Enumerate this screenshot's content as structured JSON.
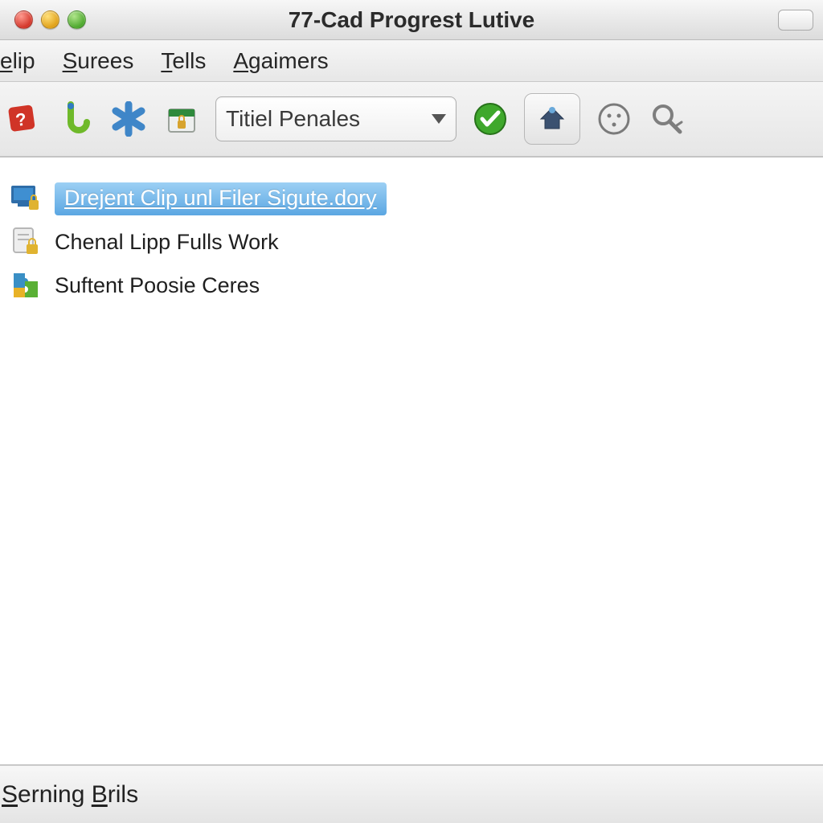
{
  "window": {
    "title": "77-Cad Progrest Lutive"
  },
  "menubar": {
    "items": [
      {
        "prefix": "",
        "mn": "e",
        "rest": "lip"
      },
      {
        "prefix": "",
        "mn": "S",
        "rest": "urees"
      },
      {
        "prefix": "",
        "mn": "T",
        "rest": "ells"
      },
      {
        "prefix": "",
        "mn": "A",
        "rest": "gaimers"
      }
    ]
  },
  "toolbar": {
    "dropdown": {
      "value": "Titiel Penales"
    }
  },
  "content": {
    "items": [
      {
        "label": "Drejent Clip unl Filer Sigute.dory",
        "selected": true,
        "icon": "monitor-lock-icon"
      },
      {
        "label": "Chenal Lipp Fulls Work",
        "selected": false,
        "icon": "doc-lock-icon"
      },
      {
        "label": "Suftent Poosie Ceres",
        "selected": false,
        "icon": "puzzle-icon"
      }
    ]
  },
  "statusbar": {
    "text_mn": "S",
    "text_after_mn": "erning ",
    "text2_mn": "B",
    "text2_after": "rils"
  }
}
